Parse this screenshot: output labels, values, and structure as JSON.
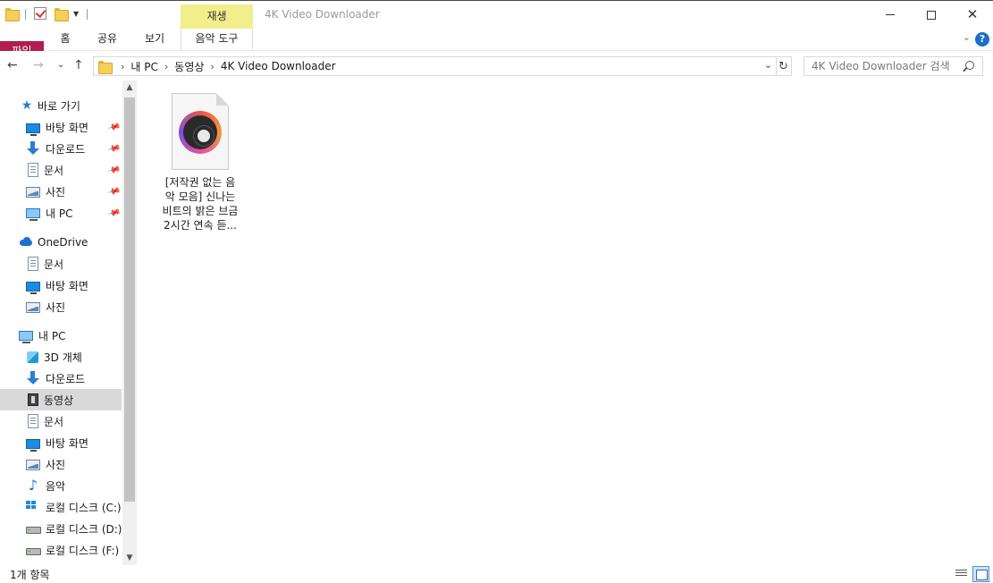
{
  "window": {
    "title": "4K Video Downloader",
    "context_group_label": "재생"
  },
  "ribbon": {
    "tabs": [
      "파일",
      "홈",
      "공유",
      "보기",
      "음악 도구"
    ]
  },
  "address": {
    "breadcrumbs": [
      "내 PC",
      "동영상",
      "4K Video Downloader"
    ],
    "search_placeholder": "4K Video Downloader 검색"
  },
  "nav": {
    "quick_access": "바로 가기",
    "quick_items": [
      {
        "label": "바탕 화면",
        "icon": "desktop-icon",
        "pinned": true
      },
      {
        "label": "다운로드",
        "icon": "download-icon",
        "pinned": true
      },
      {
        "label": "문서",
        "icon": "document-icon",
        "pinned": true
      },
      {
        "label": "사진",
        "icon": "picture-icon",
        "pinned": true
      },
      {
        "label": "내 PC",
        "icon": "pc-icon",
        "pinned": true
      }
    ],
    "onedrive": "OneDrive",
    "onedrive_items": [
      {
        "label": "문서",
        "icon": "document-icon"
      },
      {
        "label": "바탕 화면",
        "icon": "desktop-icon"
      },
      {
        "label": "사진",
        "icon": "picture-icon"
      }
    ],
    "this_pc": "내 PC",
    "pc_items": [
      {
        "label": "3D 개체",
        "icon": "3d-objects-icon"
      },
      {
        "label": "다운로드",
        "icon": "download-icon"
      },
      {
        "label": "동영상",
        "icon": "video-icon",
        "selected": true
      },
      {
        "label": "문서",
        "icon": "document-icon"
      },
      {
        "label": "바탕 화면",
        "icon": "desktop-icon"
      },
      {
        "label": "사진",
        "icon": "picture-icon"
      },
      {
        "label": "음악",
        "icon": "music-icon"
      },
      {
        "label": "로컬 디스크 (C:)",
        "icon": "system-drive-icon"
      },
      {
        "label": "로컬 디스크 (D:)",
        "icon": "drive-icon"
      },
      {
        "label": "로컬 디스크 (F:)",
        "icon": "drive-icon"
      }
    ]
  },
  "files": [
    {
      "name_lines": [
        "[저작권 없는 음",
        "악 모음] 신나는",
        "비트의 밝은 브금",
        "2시간 연속 듣..."
      ],
      "icon": "music-disc-icon"
    }
  ],
  "status": {
    "item_count": "1개 항목"
  }
}
